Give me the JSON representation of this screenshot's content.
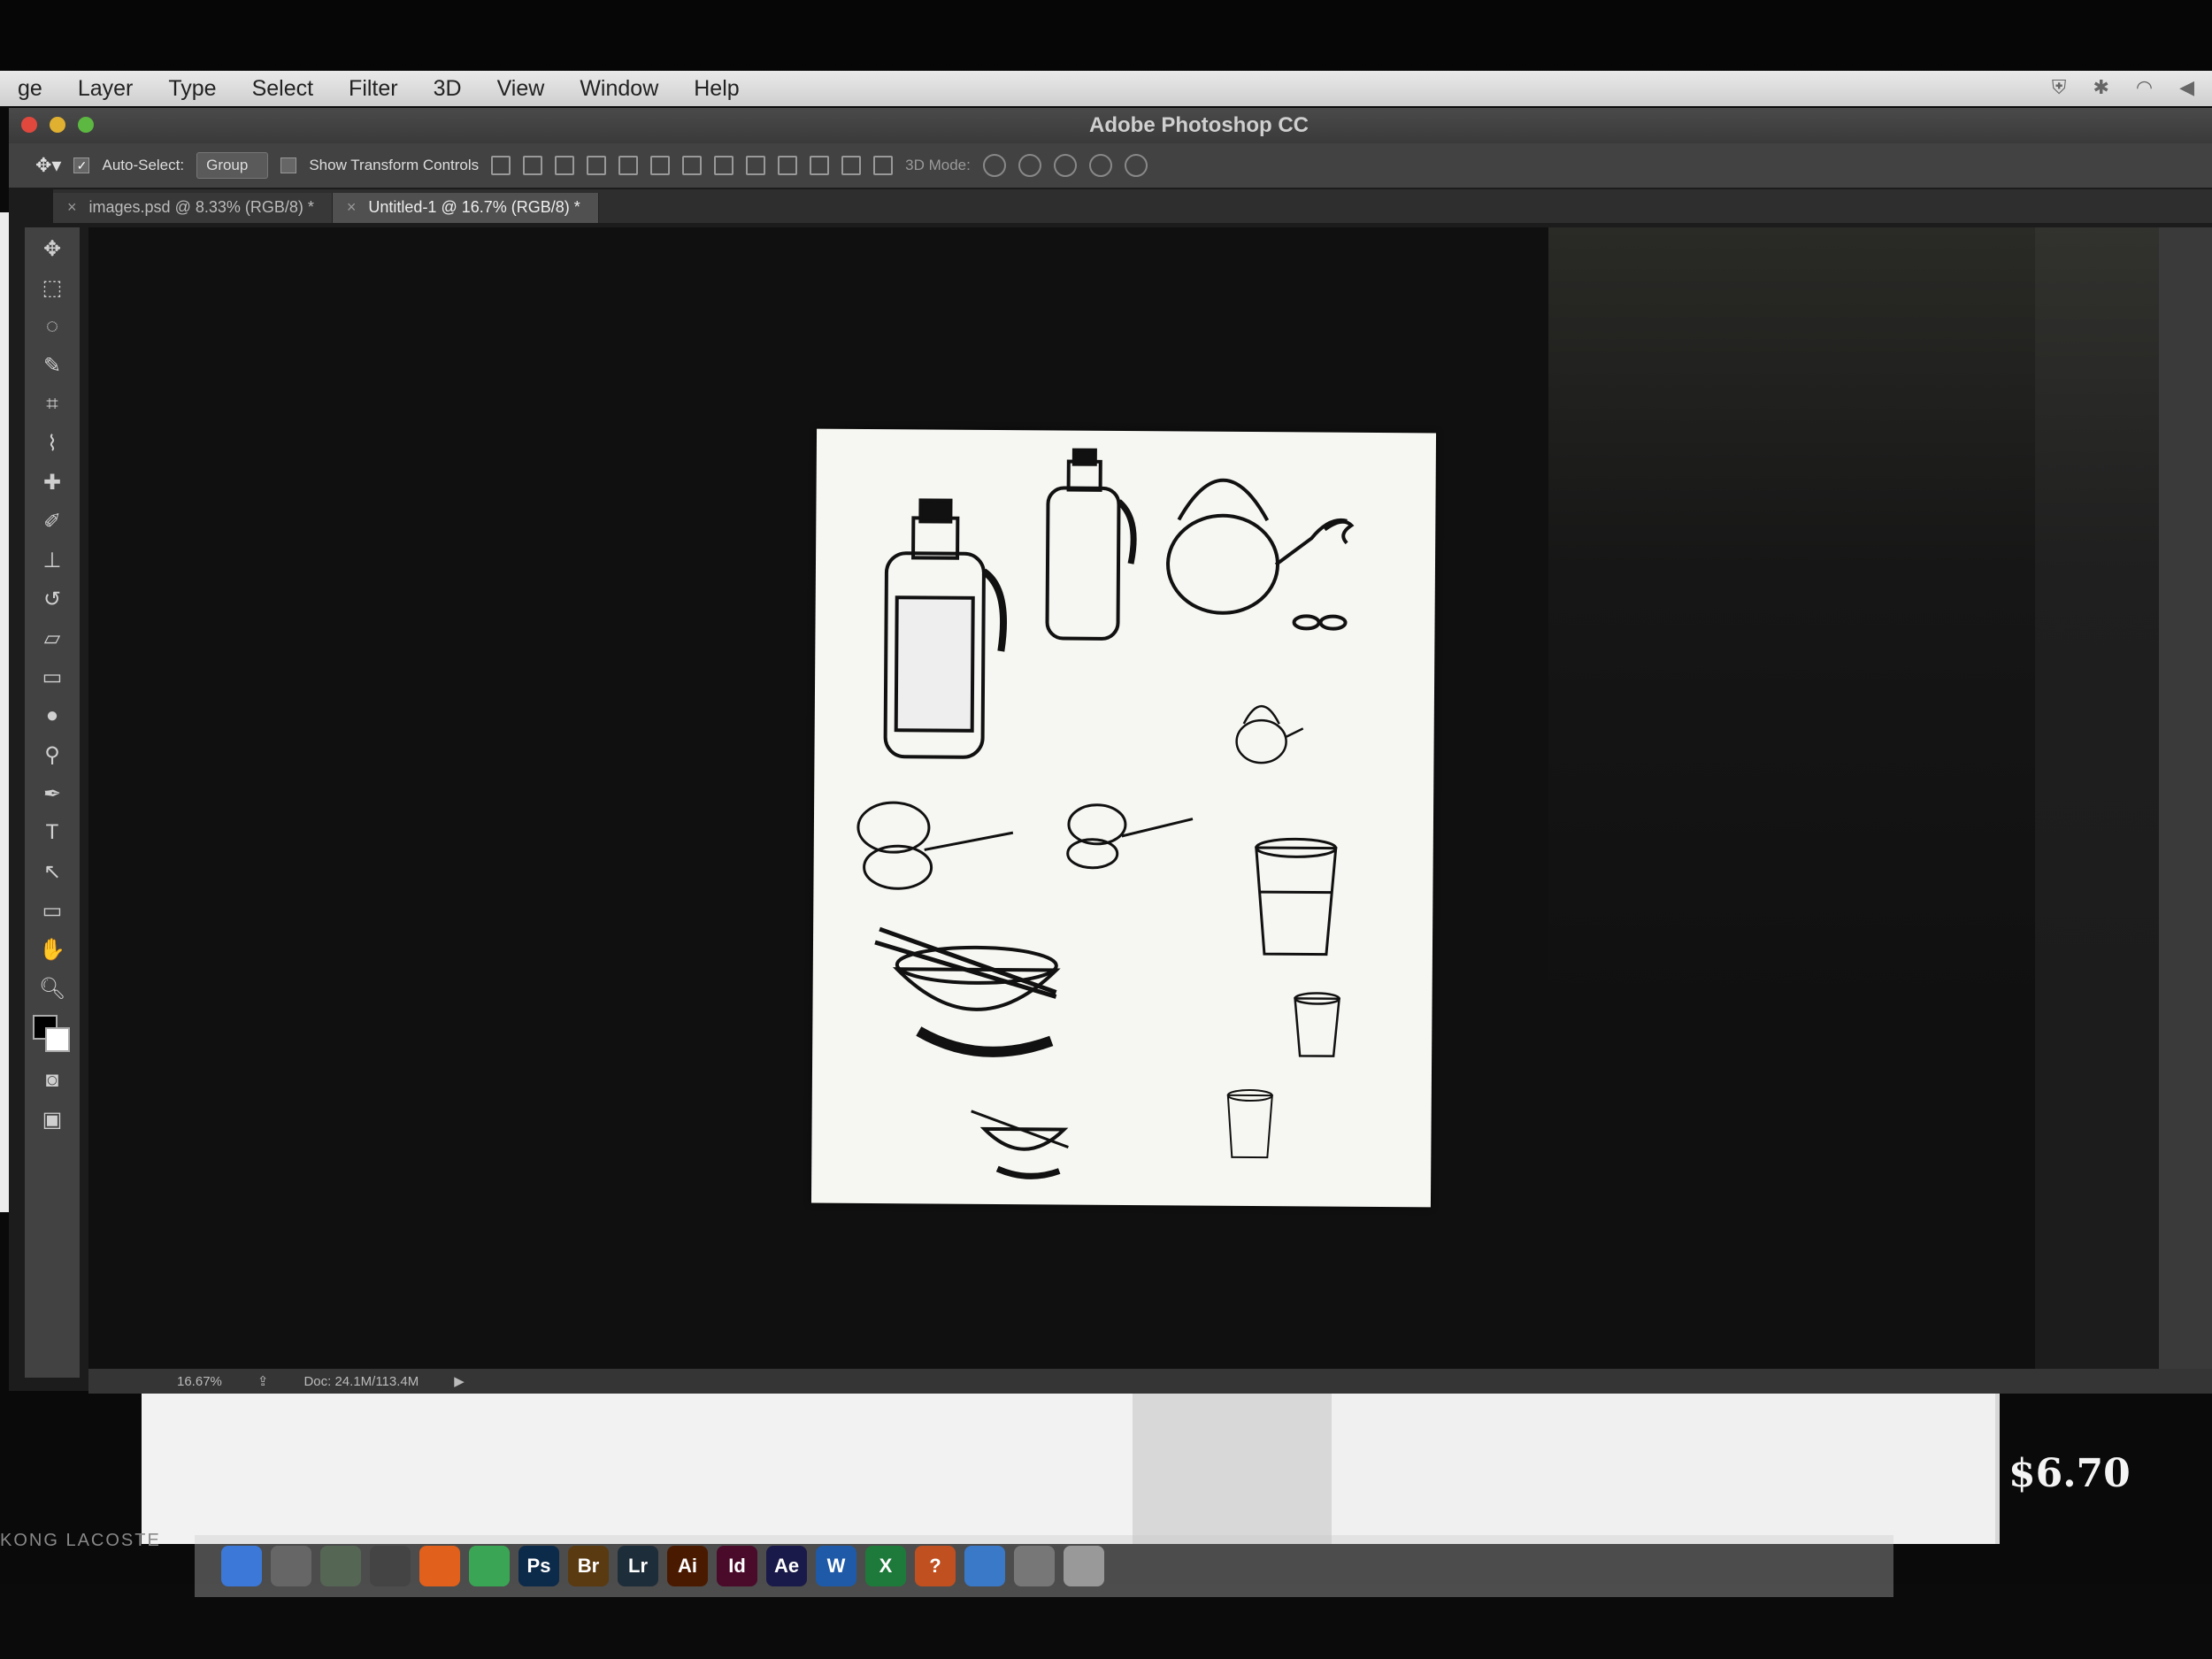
{
  "menubar": {
    "items": [
      "ge",
      "Layer",
      "Type",
      "Select",
      "Filter",
      "3D",
      "View",
      "Window",
      "Help"
    ]
  },
  "window": {
    "title": "Adobe Photoshop CC"
  },
  "options_bar": {
    "auto_select_label": "Auto-Select:",
    "auto_select_value": "Group",
    "show_transform_label": "Show Transform Controls",
    "mode_3d_label": "3D Mode:"
  },
  "tabs": [
    {
      "label": "images.psd @ 8.33% (RGB/8) *",
      "active": false
    },
    {
      "label": "Untitled-1 @ 16.7% (RGB/8) *",
      "active": true
    }
  ],
  "status": {
    "zoom": "16.67%",
    "doc": "Doc: 24.1M/113.4M"
  },
  "dock": {
    "label": "KONG   LACOSTE",
    "price": "$6.70",
    "apps": [
      {
        "icon": "finder-icon",
        "text": "",
        "color": "#3b78d8"
      },
      {
        "icon": "launchpad-icon",
        "text": "",
        "color": "#666666"
      },
      {
        "icon": "preview-icon",
        "text": "",
        "color": "#556655"
      },
      {
        "icon": "dvd-icon",
        "text": "",
        "color": "#444444"
      },
      {
        "icon": "firefox-icon",
        "text": "",
        "color": "#e0601c"
      },
      {
        "icon": "chrome-icon",
        "text": "",
        "color": "#3aa655"
      },
      {
        "icon": "photoshop-icon",
        "text": "Ps",
        "color": "#0c2a4a"
      },
      {
        "icon": "bridge-icon",
        "text": "Br",
        "color": "#5a3a10"
      },
      {
        "icon": "lightroom-icon",
        "text": "Lr",
        "color": "#1e2d3a"
      },
      {
        "icon": "illustrator-icon",
        "text": "Ai",
        "color": "#4a1a00"
      },
      {
        "icon": "indesign-icon",
        "text": "Id",
        "color": "#4a0a2a"
      },
      {
        "icon": "aftereffects-icon",
        "text": "Ae",
        "color": "#1a1a4a"
      },
      {
        "icon": "word-icon",
        "text": "W",
        "color": "#1e5aa8"
      },
      {
        "icon": "excel-icon",
        "text": "X",
        "color": "#1e7a3a"
      },
      {
        "icon": "help-icon",
        "text": "?",
        "color": "#c05020"
      },
      {
        "icon": "itunes-icon",
        "text": "",
        "color": "#3a78c8"
      },
      {
        "icon": "system-prefs-icon",
        "text": "",
        "color": "#777777"
      },
      {
        "icon": "trash-icon",
        "text": "",
        "color": "#999999"
      }
    ]
  },
  "colors": {
    "ps_panel": "#424242",
    "canvas_bg": "#101010",
    "document": "#f6f6f2"
  }
}
